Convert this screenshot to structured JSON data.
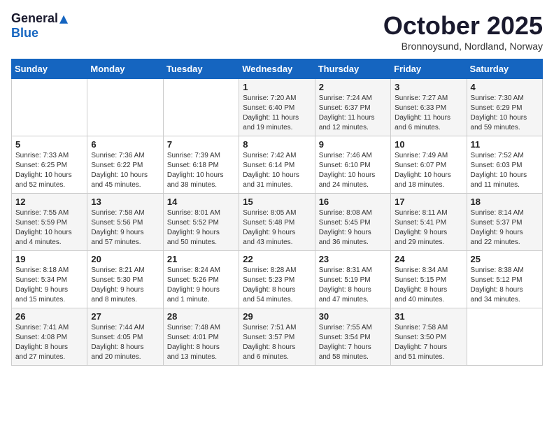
{
  "logo": {
    "general": "General",
    "blue": "Blue"
  },
  "title": "October 2025",
  "location": "Bronnoysund, Nordland, Norway",
  "weekdays": [
    "Sunday",
    "Monday",
    "Tuesday",
    "Wednesday",
    "Thursday",
    "Friday",
    "Saturday"
  ],
  "weeks": [
    [
      {
        "day": "",
        "info": ""
      },
      {
        "day": "",
        "info": ""
      },
      {
        "day": "",
        "info": ""
      },
      {
        "day": "1",
        "info": "Sunrise: 7:20 AM\nSunset: 6:40 PM\nDaylight: 11 hours\nand 19 minutes."
      },
      {
        "day": "2",
        "info": "Sunrise: 7:24 AM\nSunset: 6:37 PM\nDaylight: 11 hours\nand 12 minutes."
      },
      {
        "day": "3",
        "info": "Sunrise: 7:27 AM\nSunset: 6:33 PM\nDaylight: 11 hours\nand 6 minutes."
      },
      {
        "day": "4",
        "info": "Sunrise: 7:30 AM\nSunset: 6:29 PM\nDaylight: 10 hours\nand 59 minutes."
      }
    ],
    [
      {
        "day": "5",
        "info": "Sunrise: 7:33 AM\nSunset: 6:25 PM\nDaylight: 10 hours\nand 52 minutes."
      },
      {
        "day": "6",
        "info": "Sunrise: 7:36 AM\nSunset: 6:22 PM\nDaylight: 10 hours\nand 45 minutes."
      },
      {
        "day": "7",
        "info": "Sunrise: 7:39 AM\nSunset: 6:18 PM\nDaylight: 10 hours\nand 38 minutes."
      },
      {
        "day": "8",
        "info": "Sunrise: 7:42 AM\nSunset: 6:14 PM\nDaylight: 10 hours\nand 31 minutes."
      },
      {
        "day": "9",
        "info": "Sunrise: 7:46 AM\nSunset: 6:10 PM\nDaylight: 10 hours\nand 24 minutes."
      },
      {
        "day": "10",
        "info": "Sunrise: 7:49 AM\nSunset: 6:07 PM\nDaylight: 10 hours\nand 18 minutes."
      },
      {
        "day": "11",
        "info": "Sunrise: 7:52 AM\nSunset: 6:03 PM\nDaylight: 10 hours\nand 11 minutes."
      }
    ],
    [
      {
        "day": "12",
        "info": "Sunrise: 7:55 AM\nSunset: 5:59 PM\nDaylight: 10 hours\nand 4 minutes."
      },
      {
        "day": "13",
        "info": "Sunrise: 7:58 AM\nSunset: 5:56 PM\nDaylight: 9 hours\nand 57 minutes."
      },
      {
        "day": "14",
        "info": "Sunrise: 8:01 AM\nSunset: 5:52 PM\nDaylight: 9 hours\nand 50 minutes."
      },
      {
        "day": "15",
        "info": "Sunrise: 8:05 AM\nSunset: 5:48 PM\nDaylight: 9 hours\nand 43 minutes."
      },
      {
        "day": "16",
        "info": "Sunrise: 8:08 AM\nSunset: 5:45 PM\nDaylight: 9 hours\nand 36 minutes."
      },
      {
        "day": "17",
        "info": "Sunrise: 8:11 AM\nSunset: 5:41 PM\nDaylight: 9 hours\nand 29 minutes."
      },
      {
        "day": "18",
        "info": "Sunrise: 8:14 AM\nSunset: 5:37 PM\nDaylight: 9 hours\nand 22 minutes."
      }
    ],
    [
      {
        "day": "19",
        "info": "Sunrise: 8:18 AM\nSunset: 5:34 PM\nDaylight: 9 hours\nand 15 minutes."
      },
      {
        "day": "20",
        "info": "Sunrise: 8:21 AM\nSunset: 5:30 PM\nDaylight: 9 hours\nand 8 minutes."
      },
      {
        "day": "21",
        "info": "Sunrise: 8:24 AM\nSunset: 5:26 PM\nDaylight: 9 hours\nand 1 minute."
      },
      {
        "day": "22",
        "info": "Sunrise: 8:28 AM\nSunset: 5:23 PM\nDaylight: 8 hours\nand 54 minutes."
      },
      {
        "day": "23",
        "info": "Sunrise: 8:31 AM\nSunset: 5:19 PM\nDaylight: 8 hours\nand 47 minutes."
      },
      {
        "day": "24",
        "info": "Sunrise: 8:34 AM\nSunset: 5:15 PM\nDaylight: 8 hours\nand 40 minutes."
      },
      {
        "day": "25",
        "info": "Sunrise: 8:38 AM\nSunset: 5:12 PM\nDaylight: 8 hours\nand 34 minutes."
      }
    ],
    [
      {
        "day": "26",
        "info": "Sunrise: 7:41 AM\nSunset: 4:08 PM\nDaylight: 8 hours\nand 27 minutes."
      },
      {
        "day": "27",
        "info": "Sunrise: 7:44 AM\nSunset: 4:05 PM\nDaylight: 8 hours\nand 20 minutes."
      },
      {
        "day": "28",
        "info": "Sunrise: 7:48 AM\nSunset: 4:01 PM\nDaylight: 8 hours\nand 13 minutes."
      },
      {
        "day": "29",
        "info": "Sunrise: 7:51 AM\nSunset: 3:57 PM\nDaylight: 8 hours\nand 6 minutes."
      },
      {
        "day": "30",
        "info": "Sunrise: 7:55 AM\nSunset: 3:54 PM\nDaylight: 7 hours\nand 58 minutes."
      },
      {
        "day": "31",
        "info": "Sunrise: 7:58 AM\nSunset: 3:50 PM\nDaylight: 7 hours\nand 51 minutes."
      },
      {
        "day": "",
        "info": ""
      }
    ]
  ]
}
